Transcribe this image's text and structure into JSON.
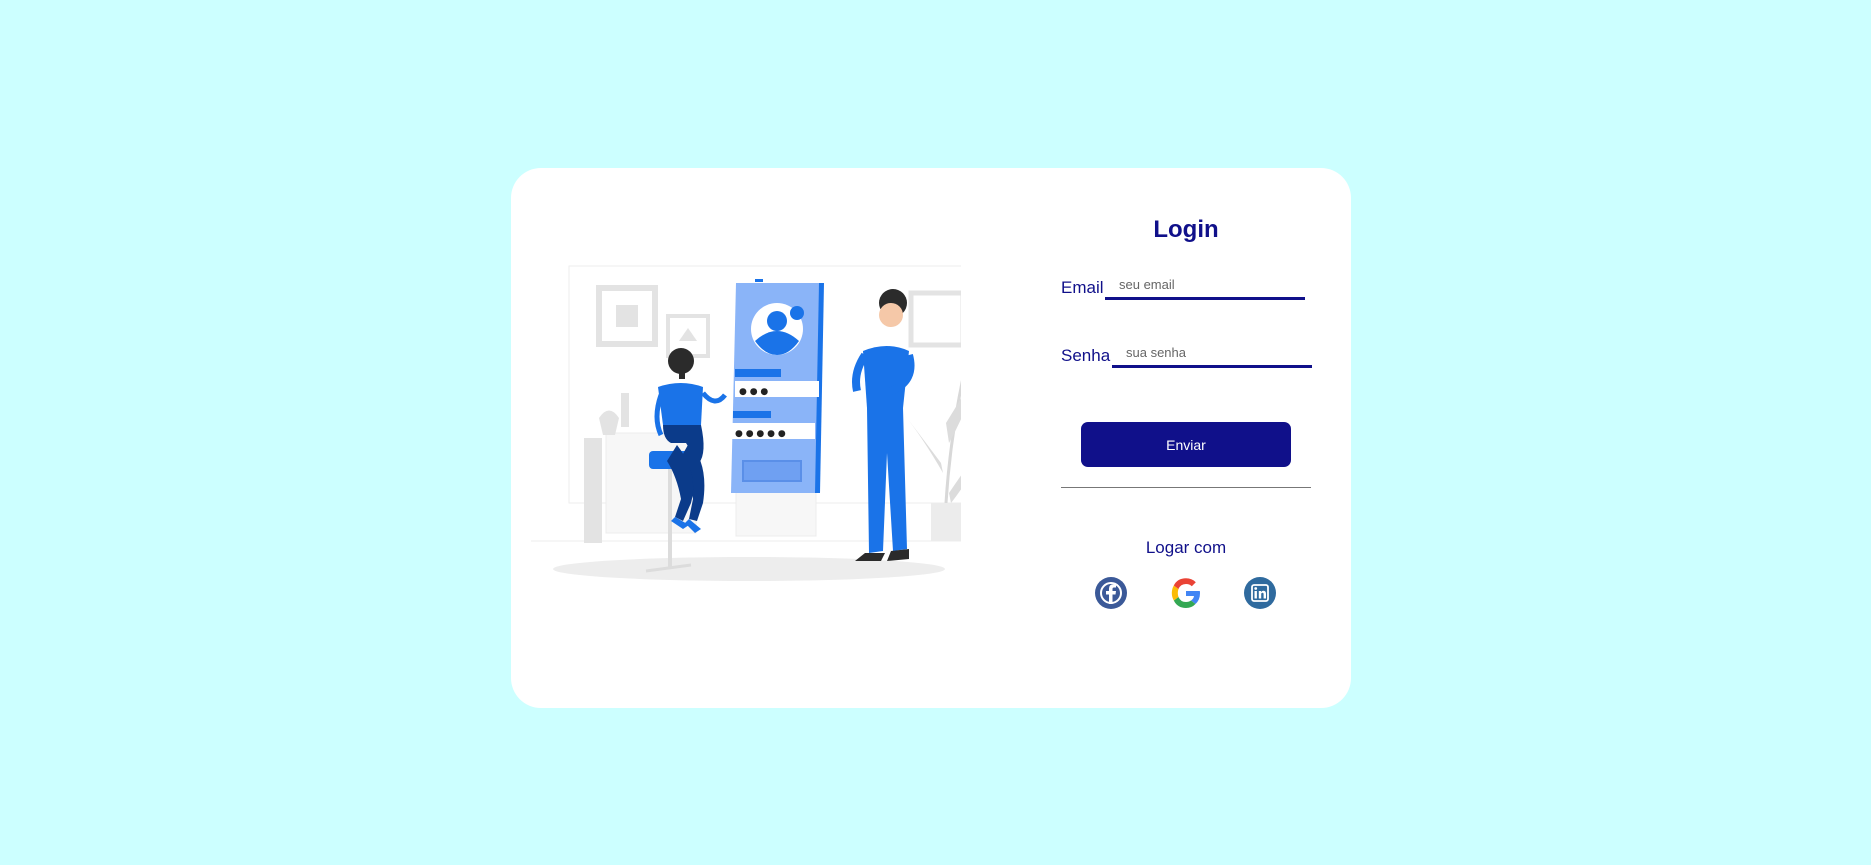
{
  "login": {
    "title": "Login",
    "email_label": "Email",
    "email_placeholder": "seu email",
    "password_label": "Senha",
    "password_placeholder": "sua senha",
    "submit_label": "Enviar",
    "social_heading": "Logar com"
  },
  "illustration": {
    "pin_dots_1": "● ● ●",
    "pin_dots_2": "● ● ● ● ●"
  },
  "social_icons": [
    "facebook-icon",
    "google-icon",
    "linkedin-icon"
  ],
  "colors": {
    "background": "#ccffff",
    "card": "#ffffff",
    "accent": "#10108a",
    "illustration_blue": "#1a73e8"
  }
}
